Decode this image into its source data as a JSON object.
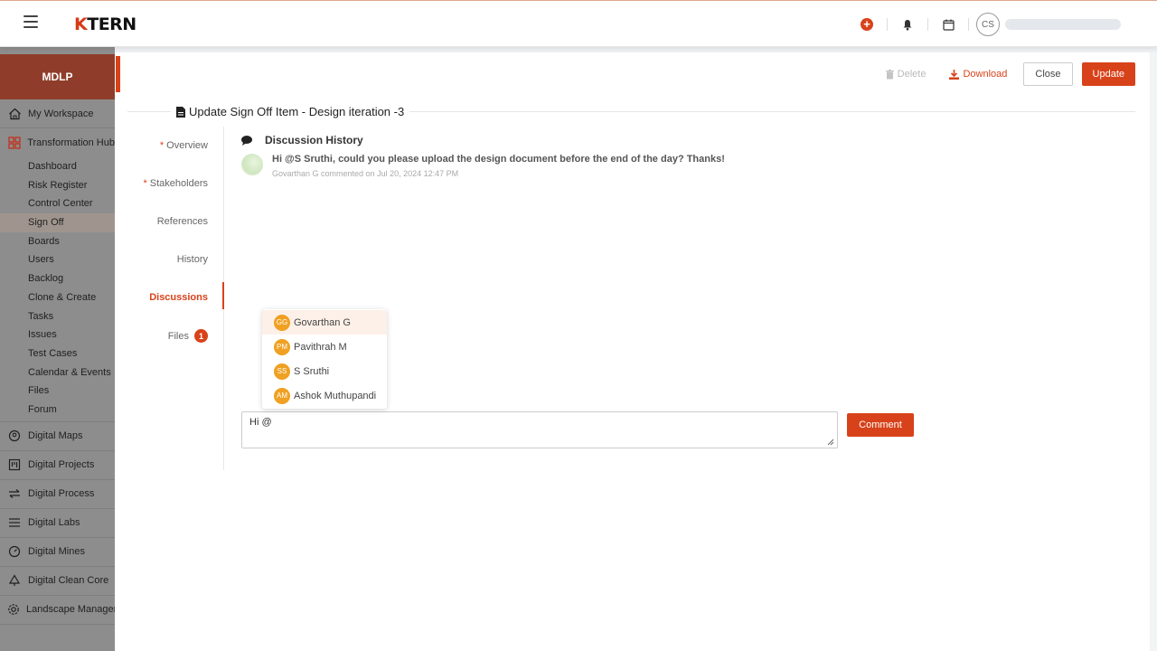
{
  "header": {
    "logo_k": "K",
    "logo_rest": "TERN",
    "user_initials": "CS"
  },
  "sidebar": {
    "brand": "MDLP",
    "my_workspace": "My Workspace",
    "transformation_hub": "Transformation Hub",
    "sub_items": [
      "Dashboard",
      "Risk Register",
      "Control Center",
      "Sign Off",
      "Boards",
      "Users",
      "Backlog",
      "Clone & Create",
      "Tasks",
      "Issues",
      "Test Cases",
      "Calendar & Events",
      "Files",
      "Forum"
    ],
    "active_sub": "Sign Off",
    "bottom_items": [
      "Digital Maps",
      "Digital Projects",
      "Digital Process",
      "Digital Labs",
      "Digital Mines",
      "Digital Clean Core",
      "Landscape Management"
    ]
  },
  "toolbar": {
    "delete": "Delete",
    "download": "Download",
    "close": "Close",
    "update": "Update"
  },
  "page": {
    "title": "Update Sign Off Item - Design iteration -3"
  },
  "nav": {
    "required_marker": "*",
    "overview": "Overview",
    "stakeholders": "Stakeholders",
    "references": "References",
    "history": "History",
    "discussions": "Discussions",
    "files": "Files",
    "files_count": "1"
  },
  "discussion": {
    "title": "Discussion History",
    "comments": [
      {
        "text": "Hi @S Sruthi, could you please upload the design document before the end of the day? Thanks!",
        "meta": "Govarthan G commented on Jul 20, 2024 12:47 PM"
      }
    ],
    "mentions": [
      {
        "initials": "GG",
        "name": "Govarthan G"
      },
      {
        "initials": "PM",
        "name": "Pavithrah M"
      },
      {
        "initials": "SS",
        "name": "S Sruthi"
      },
      {
        "initials": "AM",
        "name": "Ashok Muthupandi"
      }
    ],
    "input_value": "Hi @",
    "comment_button": "Comment"
  },
  "colors": {
    "accent": "#d8421a",
    "sidebar_bg": "#8d8d8d",
    "brand_bg": "#8f3d2a",
    "mention_avatar": "#f0a022"
  }
}
